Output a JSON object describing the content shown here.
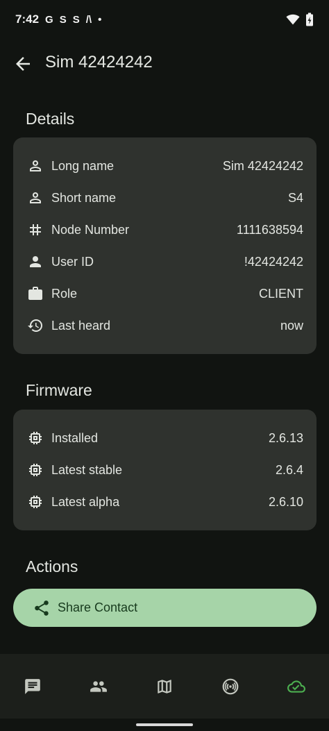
{
  "status_bar": {
    "time": "7:42",
    "notification_icons": [
      "G",
      "S",
      "S",
      "/\\",
      "•"
    ]
  },
  "app_bar": {
    "title": "Sim 42424242"
  },
  "details": {
    "title": "Details",
    "rows": [
      {
        "icon": "person-icon",
        "label": "Long name",
        "value": "Sim 42424242"
      },
      {
        "icon": "person-icon",
        "label": "Short name",
        "value": "S4"
      },
      {
        "icon": "hash-icon",
        "label": "Node Number",
        "value": "1111638594"
      },
      {
        "icon": "person-filled-icon",
        "label": "User ID",
        "value": "!42424242"
      },
      {
        "icon": "briefcase-icon",
        "label": "Role",
        "value": "CLIENT"
      },
      {
        "icon": "history-icon",
        "label": "Last heard",
        "value": "now"
      }
    ]
  },
  "firmware": {
    "title": "Firmware",
    "rows": [
      {
        "icon": "chip-icon",
        "label": "Installed",
        "value": "2.6.13"
      },
      {
        "icon": "chip-icon",
        "label": "Latest stable",
        "value": "2.6.4"
      },
      {
        "icon": "chip-icon",
        "label": "Latest alpha",
        "value": "2.6.10"
      }
    ]
  },
  "actions": {
    "title": "Actions",
    "share_label": "Share Contact"
  },
  "bottom_nav": {
    "items": [
      "messages-icon",
      "nodes-icon",
      "map-icon",
      "channels-icon",
      "connected-cloud-icon"
    ],
    "active_color": "#4caf50"
  },
  "colors": {
    "background": "#111411",
    "card": "#2f322e",
    "button": "#a6d4a8"
  }
}
